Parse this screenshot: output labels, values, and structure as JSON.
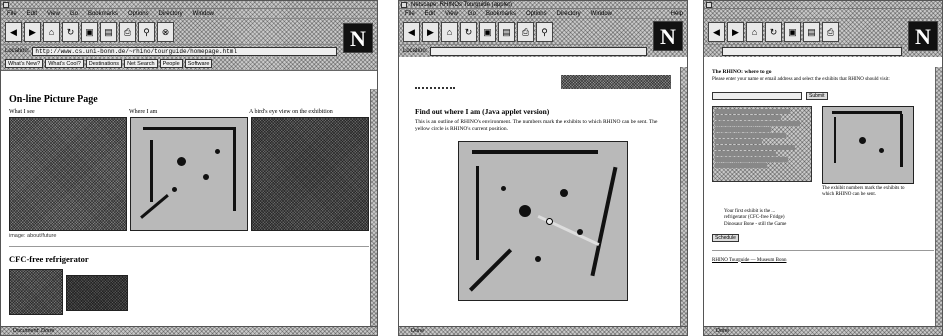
{
  "win1": {
    "menus": [
      "File",
      "Edit",
      "View",
      "Go",
      "Bookmarks",
      "Options",
      "Directory",
      "Window"
    ],
    "location_label": "Location:",
    "url": "http://www.cs.uni-bonn.de/~rhino/tourguide/homepage.html",
    "dir_buttons": [
      "What's New?",
      "What's Cool?",
      "Destinations",
      "Net Search",
      "People",
      "Software"
    ],
    "page_title": "On-line Picture Page",
    "captions": [
      "What I see",
      "Where I am",
      "A bird's eye view on the exhibition"
    ],
    "image_note": "image: about/future",
    "section_title": "CFC-free refrigerator",
    "status": "Document: Done"
  },
  "win2": {
    "title": "Netscape: RHINOs Tourguide (applet)",
    "menus": [
      "File",
      "Edit",
      "View",
      "Go",
      "Bookmarks",
      "Options",
      "Directory",
      "Window"
    ],
    "help": "Help",
    "location_label": "Location:",
    "heading": "Find out where I am (Java applet version)",
    "body": "This is an outline of RHINO's environment. The numbers mark the exhibits to which RHINO can be sent. The yellow circle is RHINO's current position.",
    "status": "Done"
  },
  "win3": {
    "title": "The RHINO: where to go",
    "intro": "Please enter your name or email address and select the exhibits that RHINO should visit:",
    "button": "Submit",
    "note": "The exhibit numbers mark the exhibits to which RHINO can be sent.",
    "list_items": [
      "Your first exhibit is the ...",
      "refrigerator (CFC-free Fridge)",
      "Dinosaur Bone - still the Game"
    ],
    "confirm_button": "Schedule",
    "footer": "RHINO Tourguide — Museum Bonn",
    "status": "Done"
  },
  "colors": {
    "chrome": "#c9c9c9",
    "dark": "#111111"
  }
}
